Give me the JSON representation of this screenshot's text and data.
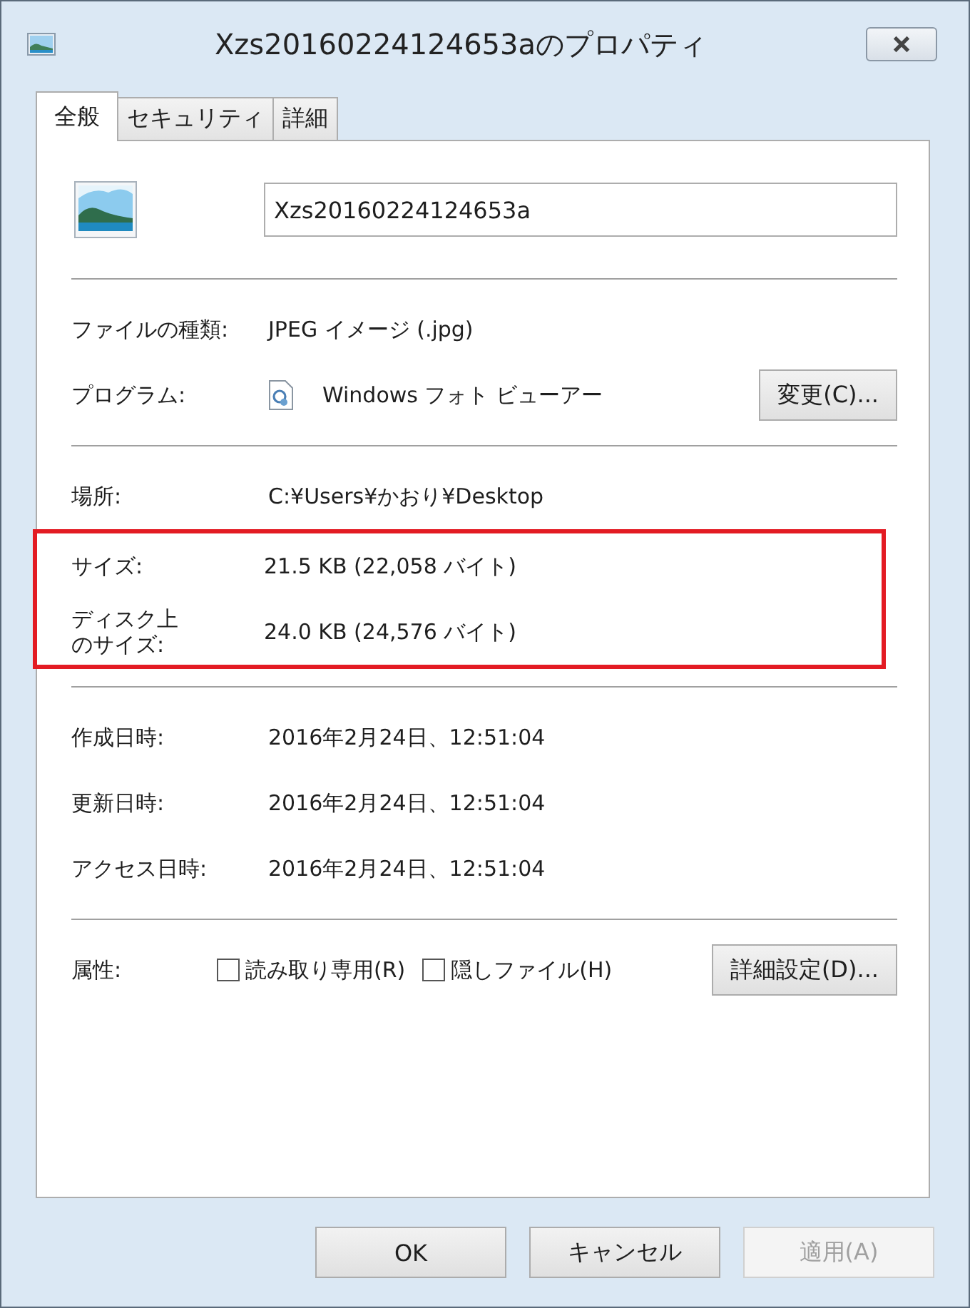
{
  "window": {
    "title": "Xzs20160224124653aのプロパティ"
  },
  "tabs": [
    {
      "label": "全般",
      "selected": true
    },
    {
      "label": "セキュリティ",
      "selected": false
    },
    {
      "label": "詳細",
      "selected": false
    }
  ],
  "file_name": "Xzs20160224124653a",
  "sections": [
    {
      "groups": [
        {
          "highlighted": false,
          "rows": [
            {
              "kind": "text",
              "label": "ファイルの種類:",
              "value": "JPEG イメージ (.jpg)"
            },
            {
              "kind": "program",
              "label": "プログラム:",
              "value": "Windows フォト ビューアー",
              "button": "変更(C)..."
            }
          ]
        }
      ]
    },
    {
      "groups": [
        {
          "highlighted": false,
          "rows": [
            {
              "kind": "text",
              "label": "場所:",
              "value": "C:¥Users¥かおり¥Desktop"
            }
          ]
        },
        {
          "highlighted": true,
          "rows": [
            {
              "kind": "text",
              "label": "サイズ:",
              "value": "21.5 KB (22,058 バイト)"
            },
            {
              "kind": "text",
              "label": "ディスク上のサイズ:",
              "value": "24.0 KB (24,576 バイト)"
            }
          ]
        }
      ]
    },
    {
      "groups": [
        {
          "highlighted": false,
          "rows": [
            {
              "kind": "text",
              "label": "作成日時:",
              "value": "2016年2月24日、12:51:04"
            },
            {
              "kind": "text",
              "label": "更新日時:",
              "value": "2016年2月24日、12:51:04"
            },
            {
              "kind": "text",
              "label": "アクセス日時:",
              "value": "2016年2月24日、12:51:04"
            }
          ]
        }
      ]
    },
    {
      "groups": [
        {
          "highlighted": false,
          "rows": [
            {
              "kind": "attributes",
              "label": "属性:",
              "checkboxes": [
                {
                  "label": "読み取り専用(R)",
                  "checked": false
                },
                {
                  "label": "隠しファイル(H)",
                  "checked": false
                }
              ],
              "button": "詳細設定(D)..."
            }
          ]
        }
      ]
    }
  ],
  "buttons": [
    {
      "label": "OK",
      "disabled": false
    },
    {
      "label": "キャンセル",
      "disabled": false
    },
    {
      "label": "適用(A)",
      "disabled": true
    }
  ]
}
